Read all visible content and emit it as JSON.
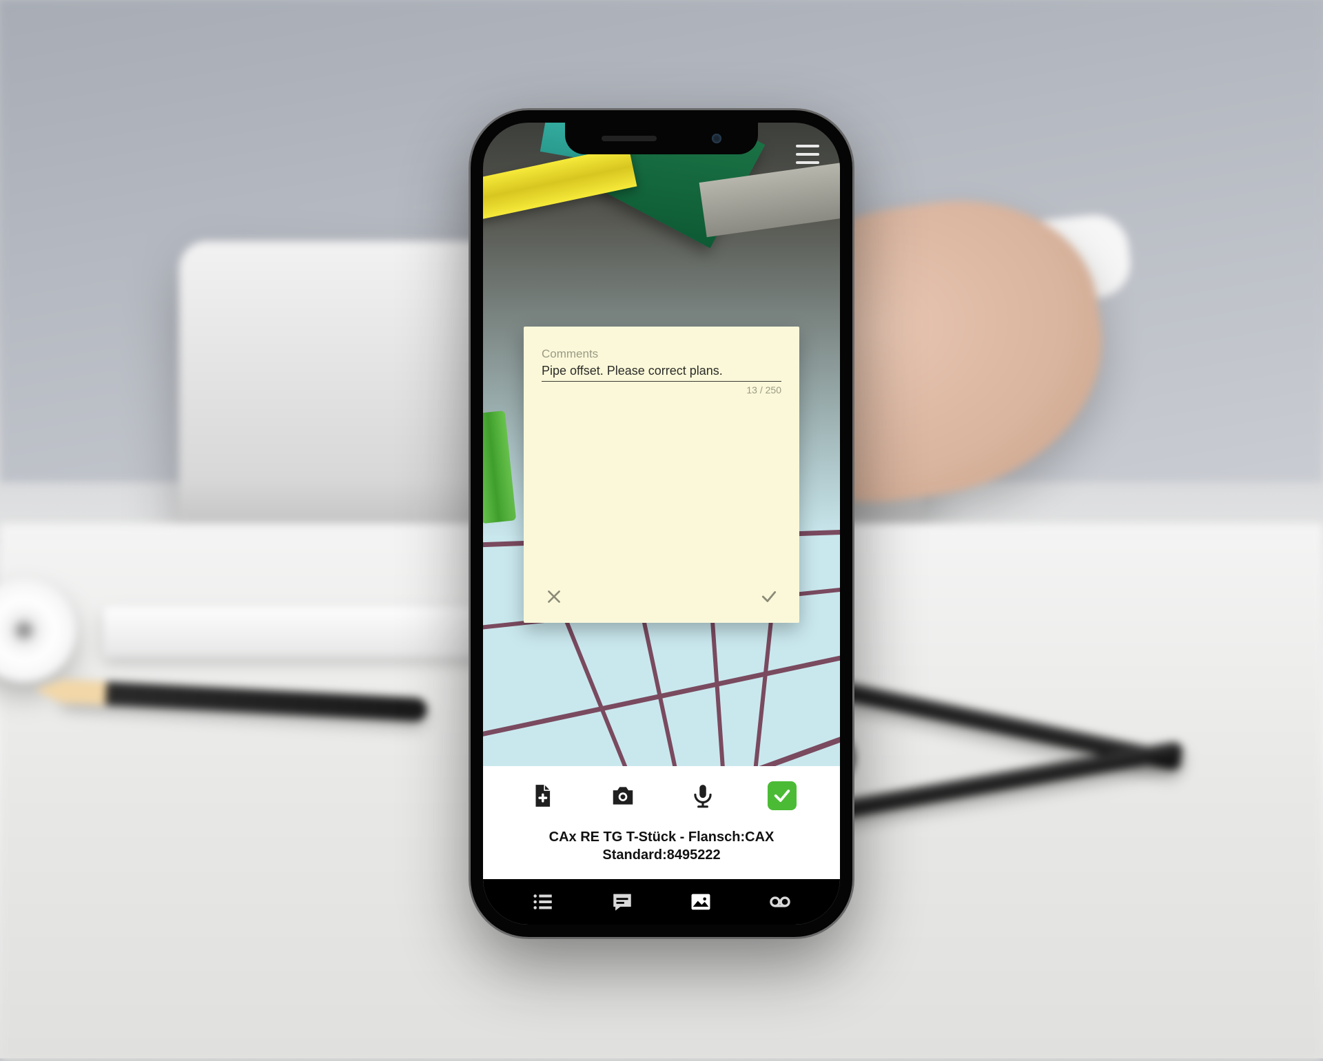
{
  "header": {
    "menu_icon": "hamburger"
  },
  "note": {
    "label": "Comments",
    "value": "Pipe offset. Please correct plans.",
    "counter": "13 / 250"
  },
  "action_bar": {
    "info_line1": "CAx RE TG T-Stück - Flansch:CAX",
    "info_line2": "Standard:8495222"
  },
  "icons": {
    "add_file": "add-file-icon",
    "camera": "camera-icon",
    "mic": "microphone-icon",
    "confirm": "check-icon",
    "nav_list": "list-icon",
    "nav_comment": "comment-icon",
    "nav_image": "image-icon",
    "nav_voice": "voicemail-icon"
  },
  "colors": {
    "confirm_bg": "#4bbb35",
    "note_bg": "#faf8d9"
  }
}
